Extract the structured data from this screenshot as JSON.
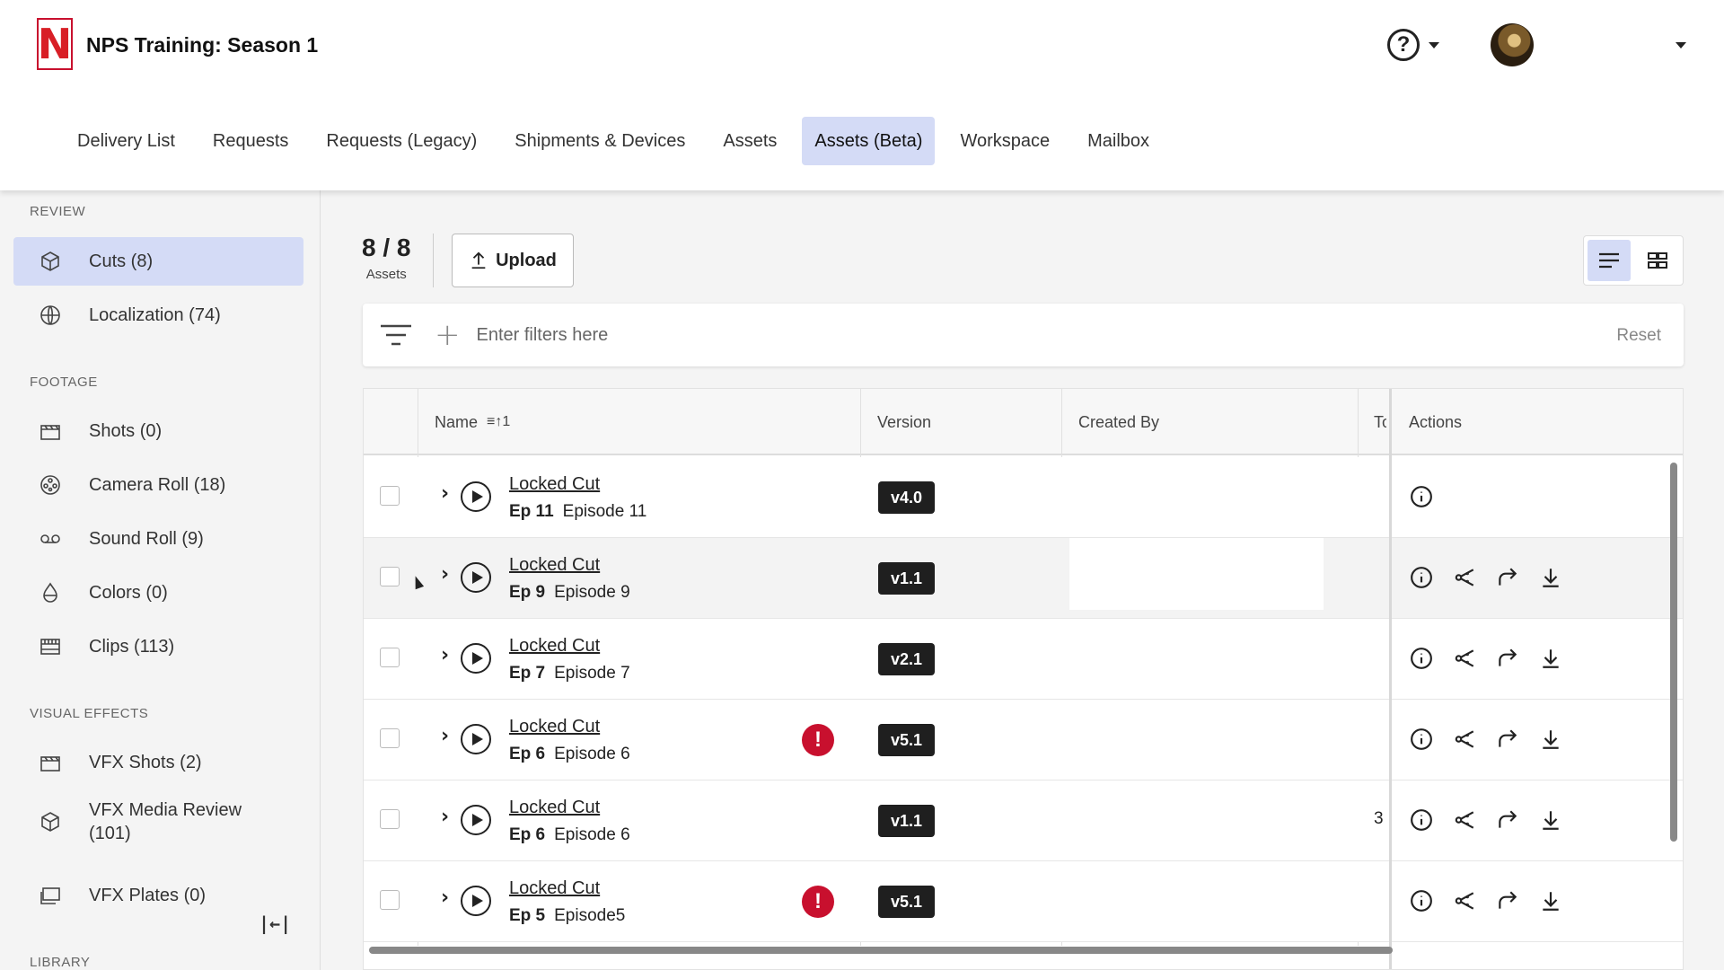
{
  "app": {
    "logo_letter": "N",
    "title": "NPS Training: Season 1",
    "help_icon": "?"
  },
  "nav": {
    "tabs": [
      {
        "label": "Delivery List",
        "active": false
      },
      {
        "label": "Requests",
        "active": false
      },
      {
        "label": "Requests (Legacy)",
        "active": false
      },
      {
        "label": "Shipments & Devices",
        "active": false
      },
      {
        "label": "Assets",
        "active": false
      },
      {
        "label": "Assets (Beta)",
        "active": true
      },
      {
        "label": "Workspace",
        "active": false
      },
      {
        "label": "Mailbox",
        "active": false
      }
    ]
  },
  "sidebar": {
    "sections": {
      "review": "REVIEW",
      "footage": "FOOTAGE",
      "vfx": "VISUAL EFFECTS",
      "library": "LIBRARY"
    },
    "items": [
      {
        "label": "Cuts (8)",
        "icon": "cube-icon",
        "active": true
      },
      {
        "label": "Localization (74)",
        "icon": "globe-icon",
        "active": false
      },
      {
        "label": "Shots (0)",
        "icon": "clapper-icon",
        "active": false
      },
      {
        "label": "Camera Roll (18)",
        "icon": "film-reel-icon",
        "active": false
      },
      {
        "label": "Sound Roll (9)",
        "icon": "tape-icon",
        "active": false
      },
      {
        "label": "Colors (0)",
        "icon": "drop-icon",
        "active": false
      },
      {
        "label": "Clips (113)",
        "icon": "film-strip-icon",
        "active": false
      },
      {
        "label": "VFX Shots (2)",
        "icon": "clapper-icon",
        "active": false
      },
      {
        "label": "VFX Media Review (101)",
        "icon": "cube-icon",
        "active": false
      },
      {
        "label": "VFX Plates (0)",
        "icon": "plates-icon",
        "active": false
      }
    ],
    "collapse_icon": "|←|"
  },
  "toolbar": {
    "count": "8 / 8",
    "count_label": "Assets",
    "upload_label": "Upload"
  },
  "filter": {
    "placeholder": "Enter filters here",
    "reset_label": "Reset"
  },
  "table": {
    "headers": {
      "name": "Name",
      "sort_indicator": "≡↑1",
      "version": "Version",
      "created_by": "Created By",
      "to": "To",
      "actions": "Actions"
    },
    "rows": [
      {
        "name": "Locked Cut",
        "ep": "Ep 11",
        "episode": "Episode 11",
        "version": "v4.0",
        "warning": false,
        "to": "",
        "actions": [
          "info-icon"
        ]
      },
      {
        "name": "Locked Cut",
        "ep": "Ep 9",
        "episode": "Episode 9",
        "version": "v1.1",
        "warning": false,
        "to": "",
        "actions": [
          "info-icon",
          "share-icon",
          "forward-icon",
          "download-icon"
        ]
      },
      {
        "name": "Locked Cut",
        "ep": "Ep 7",
        "episode": "Episode 7",
        "version": "v2.1",
        "warning": false,
        "to": "",
        "actions": [
          "info-icon",
          "share-icon",
          "forward-icon",
          "download-icon"
        ]
      },
      {
        "name": "Locked Cut",
        "ep": "Ep 6",
        "episode": "Episode 6",
        "version": "v5.1",
        "warning": true,
        "to": "",
        "actions": [
          "info-icon",
          "share-icon",
          "forward-icon",
          "download-icon"
        ]
      },
      {
        "name": "Locked Cut",
        "ep": "Ep 6",
        "episode": "Episode 6",
        "version": "v1.1",
        "warning": false,
        "to": "3",
        "actions": [
          "info-icon",
          "share-icon",
          "forward-icon",
          "download-icon"
        ]
      },
      {
        "name": "Locked Cut",
        "ep": "Ep 5",
        "episode": "Episode5",
        "version": "v5.1",
        "warning": true,
        "to": "",
        "actions": [
          "info-icon",
          "share-icon",
          "forward-icon",
          "download-icon"
        ]
      }
    ],
    "warning_glyph": "!"
  }
}
